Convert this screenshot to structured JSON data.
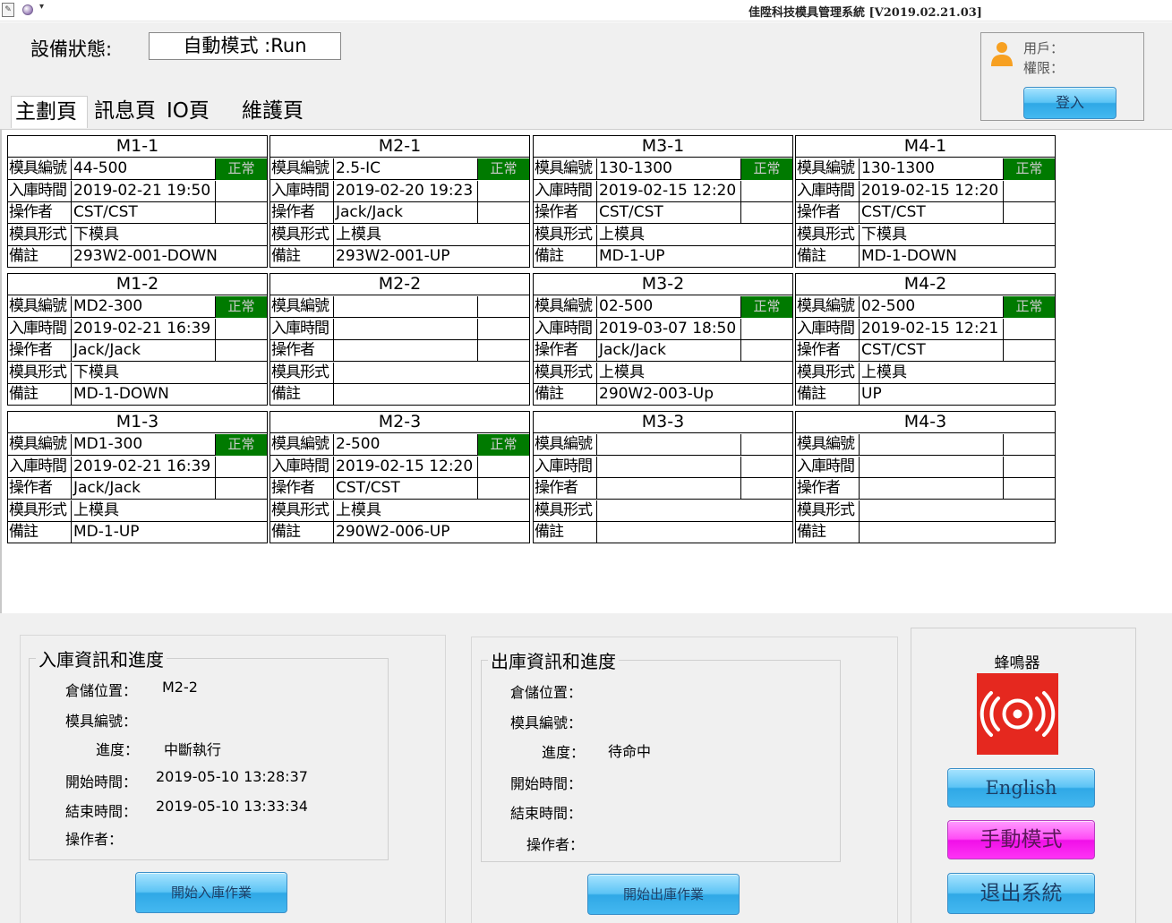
{
  "window": {
    "title": "佳陞科技模具管理系統 [V2019.02.21.03]"
  },
  "header": {
    "status_label": "設備狀態:",
    "status_value": "自動模式 :Run",
    "user_label": "用戶：",
    "perm_label": "權限：",
    "login_label": "登入"
  },
  "tabs": [
    "主劃頁",
    "訊息頁",
    "IO頁",
    "維護頁"
  ],
  "grid": {
    "field_labels": {
      "mold_id": "模具編號",
      "in_time": "入庫時間",
      "operator": "操作者",
      "mold_type": "模具形式",
      "remark": "備註"
    },
    "cells": [
      {
        "name": "M1-1",
        "mold_id": "44-500",
        "status": "正常",
        "in_time": "2019-02-21 19:50",
        "operator": "CST/CST",
        "mold_type": "下模具",
        "remark": "293W2-001-DOWN"
      },
      {
        "name": "M2-1",
        "mold_id": "2.5-IC",
        "status": "正常",
        "in_time": "2019-02-20 19:23",
        "operator": "Jack/Jack",
        "mold_type": "上模具",
        "remark": "293W2-001-UP"
      },
      {
        "name": "M3-1",
        "mold_id": "130-1300",
        "status": "正常",
        "in_time": "2019-02-15 12:20",
        "operator": "CST/CST",
        "mold_type": "上模具",
        "remark": "MD-1-UP"
      },
      {
        "name": "M4-1",
        "mold_id": "130-1300",
        "status": "正常",
        "in_time": "2019-02-15 12:20",
        "operator": "CST/CST",
        "mold_type": "下模具",
        "remark": "MD-1-DOWN"
      },
      {
        "name": "M1-2",
        "mold_id": "MD2-300",
        "status": "正常",
        "in_time": "2019-02-21 16:39",
        "operator": "Jack/Jack",
        "mold_type": "下模具",
        "remark": "MD-1-DOWN"
      },
      {
        "name": "M2-2",
        "mold_id": "",
        "status": "",
        "in_time": "",
        "operator": "",
        "mold_type": "",
        "remark": ""
      },
      {
        "name": "M3-2",
        "mold_id": "02-500",
        "status": "正常",
        "in_time": "2019-03-07 18:50",
        "operator": "Jack/Jack",
        "mold_type": "上模具",
        "remark": "290W2-003-Up"
      },
      {
        "name": "M4-2",
        "mold_id": "02-500",
        "status": "正常",
        "in_time": "2019-02-15 12:21",
        "operator": "CST/CST",
        "mold_type": "上模具",
        "remark": "UP"
      },
      {
        "name": "M1-3",
        "mold_id": "MD1-300",
        "status": "正常",
        "in_time": "2019-02-21 16:39",
        "operator": "Jack/Jack",
        "mold_type": "上模具",
        "remark": "MD-1-UP"
      },
      {
        "name": "M2-3",
        "mold_id": "2-500",
        "status": "正常",
        "in_time": "2019-02-15 12:20",
        "operator": "CST/CST",
        "mold_type": "上模具",
        "remark": "290W2-006-UP"
      },
      {
        "name": "M3-3",
        "mold_id": "",
        "status": "",
        "in_time": "",
        "operator": "",
        "mold_type": "",
        "remark": ""
      },
      {
        "name": "M4-3",
        "mold_id": "",
        "status": "",
        "in_time": "",
        "operator": "",
        "mold_type": "",
        "remark": ""
      }
    ]
  },
  "inbound": {
    "title": "入庫資訊和進度",
    "location_label": "倉儲位置：",
    "location_value": "M2-2",
    "mold_id_label": "模具編號：",
    "mold_id_value": "",
    "progress_label": "進度：",
    "progress_value": "中斷執行",
    "start_label": "開始時間：",
    "start_value": "2019-05-10 13:28:37",
    "end_label": "結束時間：",
    "end_value": "2019-05-10 13:33:34",
    "operator_label": "操作者：",
    "operator_value": "",
    "button_label": "開始入庫作業"
  },
  "outbound": {
    "title": "出庫資訊和進度",
    "location_label": "倉儲位置：",
    "location_value": "",
    "mold_id_label": "模具編號：",
    "mold_id_value": "",
    "progress_label": "進度：",
    "progress_value": "待命中",
    "start_label": "開始時間：",
    "start_value": "",
    "end_label": "結束時間：",
    "end_value": "",
    "operator_label": "操作者：",
    "operator_value": "",
    "button_label": "開始出庫作業"
  },
  "side": {
    "buzzer_label": "蜂鳴器",
    "buzzer_icon": "alarm-icon",
    "english_label": "English",
    "manual_label": "手動模式",
    "exit_label": "退出系統"
  },
  "colors": {
    "status_ok": "#007a00",
    "blue_button": "#44b8f0",
    "magenta_button": "#ff33f5",
    "buzzer_red": "#e5281f"
  }
}
